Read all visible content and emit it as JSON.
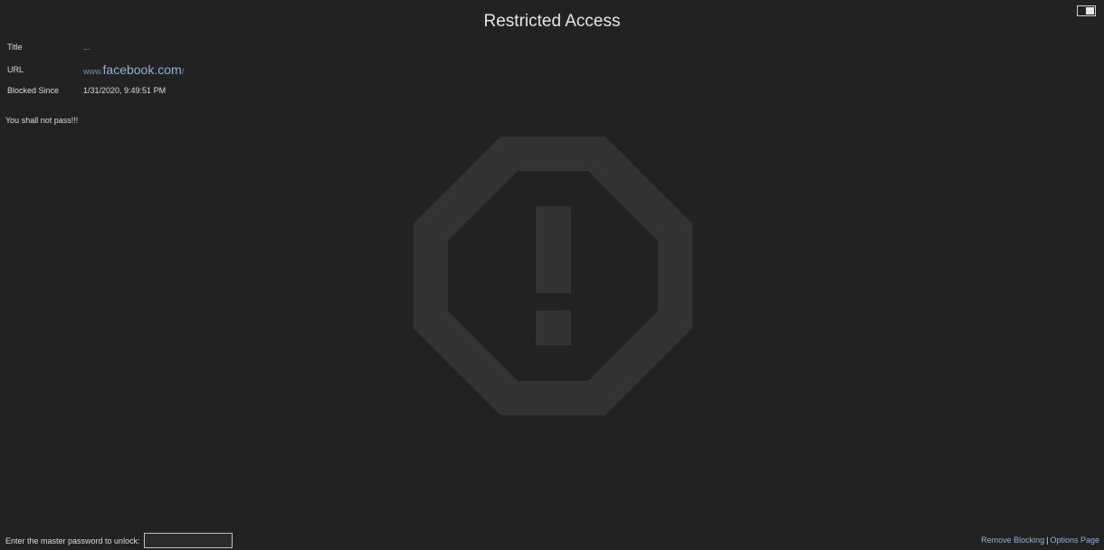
{
  "page": {
    "title": "Restricted Access",
    "message": "You shall not pass!!!"
  },
  "info": {
    "title_label": "Title",
    "title_value": "...",
    "url_label": "URL",
    "url_sub": "www.",
    "url_domain": "facebook.com",
    "url_path": "/",
    "since_label": "Blocked Since",
    "since_value": "1/31/2020, 9:49:51 PM"
  },
  "unlock": {
    "prompt": "Enter the master password to unlock:",
    "value": ""
  },
  "footer": {
    "remove_label": "Remove Blocking",
    "separator": "|",
    "options_label": "Options Page"
  },
  "icons": {
    "main": "warning-octagon-icon",
    "toggle": "theme-toggle-icon"
  },
  "colors": {
    "background": "#222222",
    "text": "#dddddd",
    "link": "#8fb3d9",
    "icon": "#333333"
  }
}
